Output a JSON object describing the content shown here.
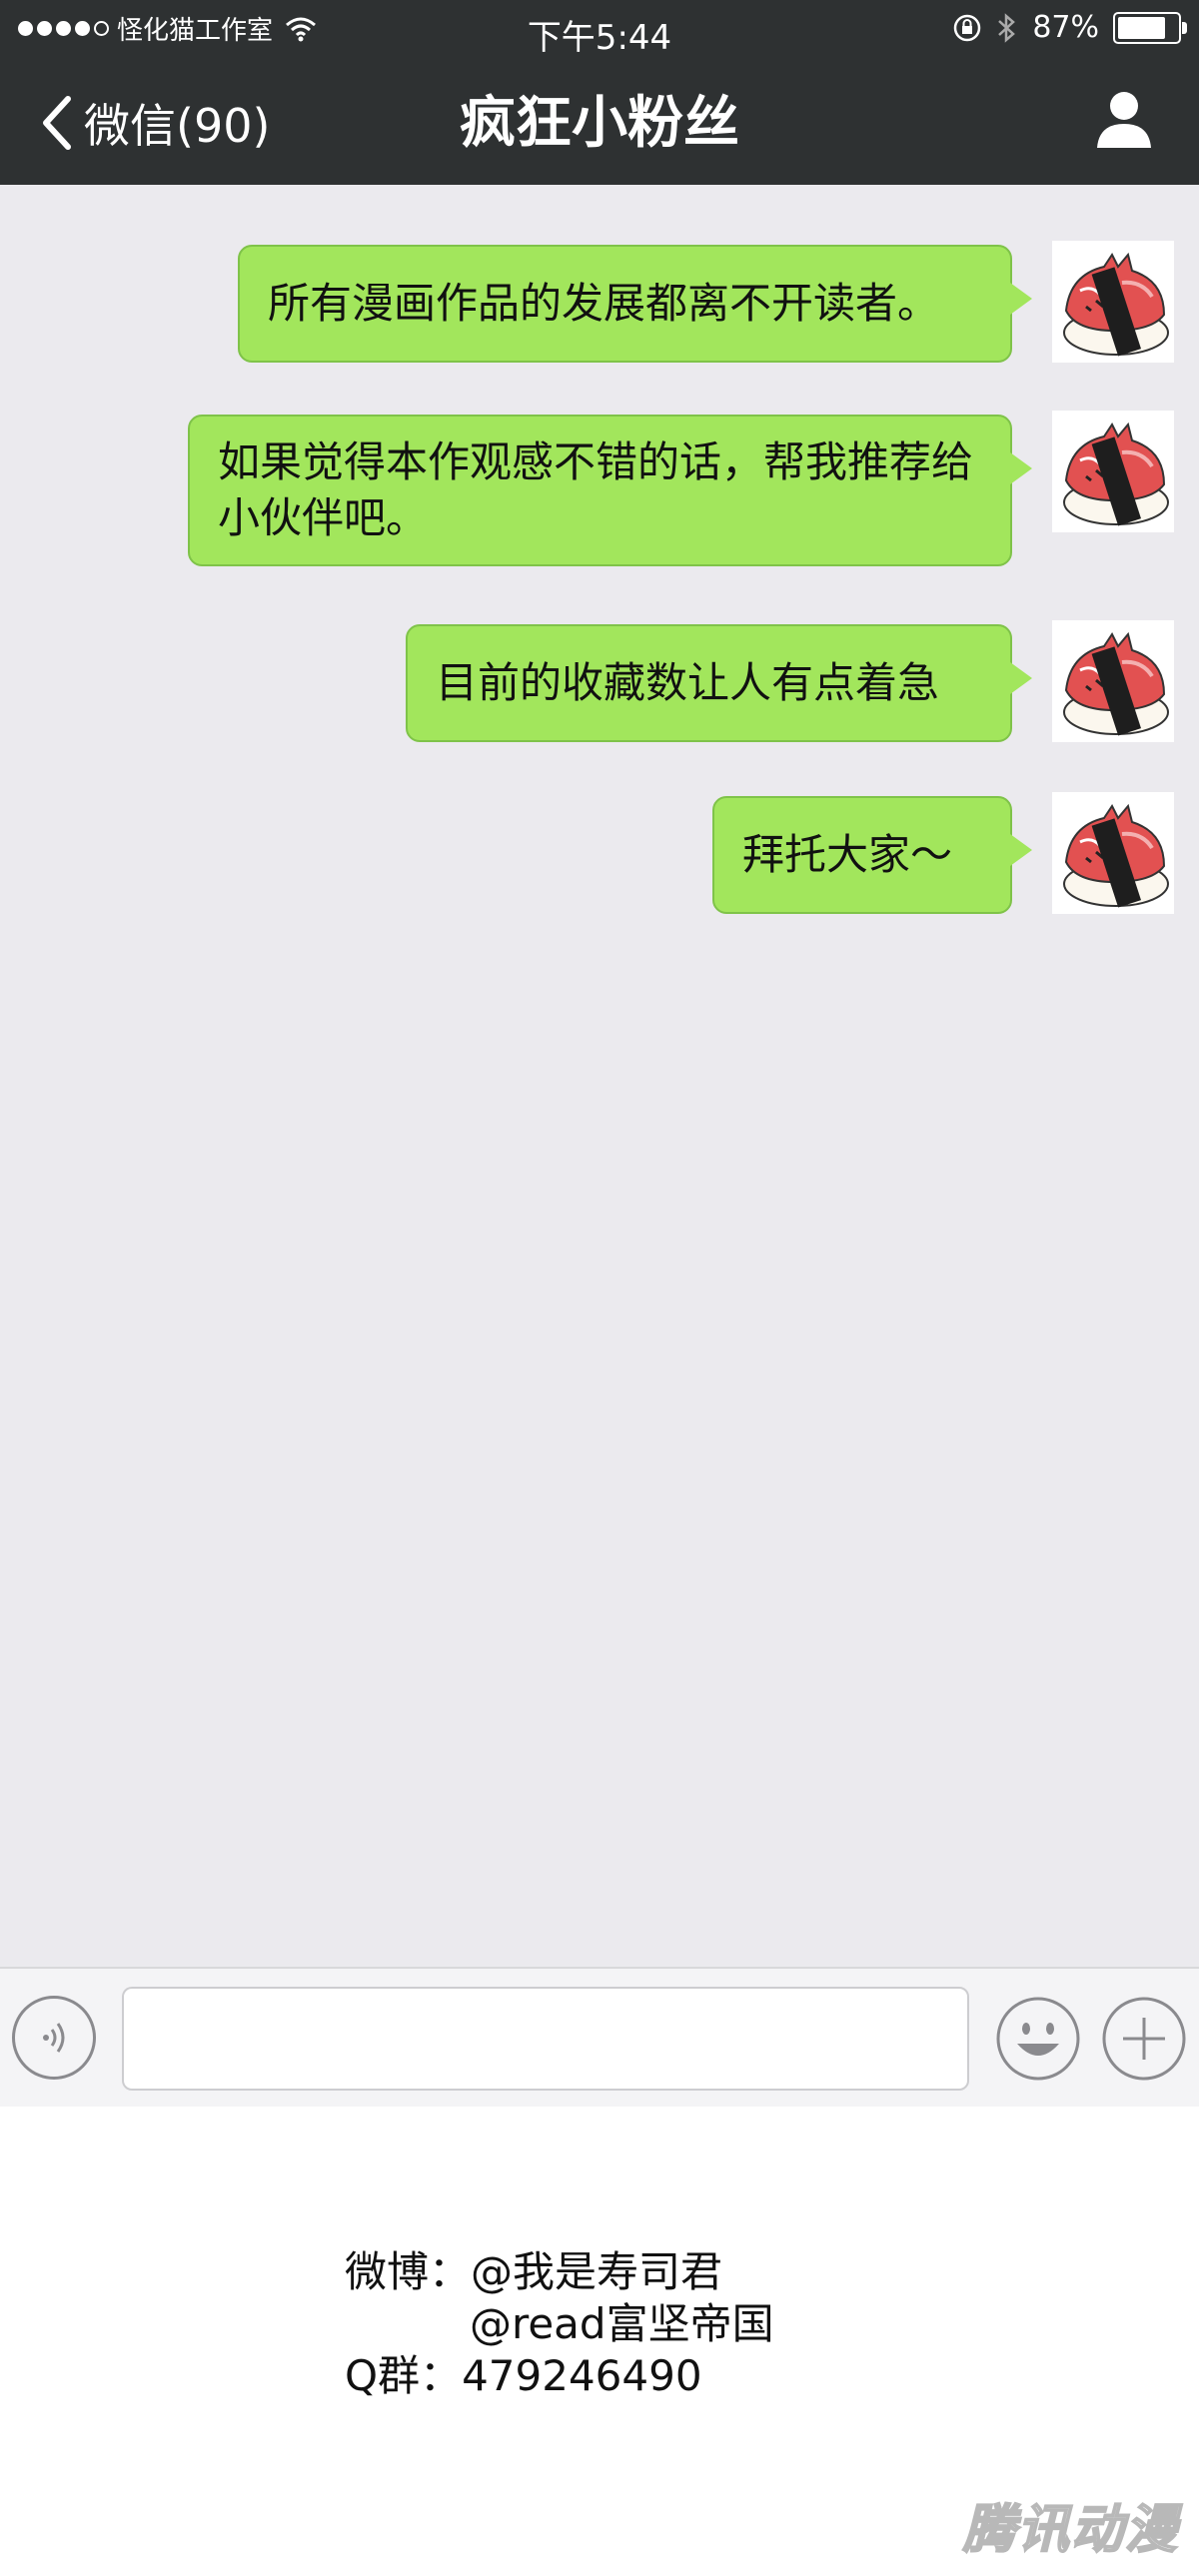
{
  "status_bar": {
    "carrier": "怪化猫工作室",
    "time": "下午5:44",
    "battery": "87%",
    "battery_level": 0.87
  },
  "nav": {
    "back_label": "微信(90)",
    "title": "疯狂小粉丝",
    "profile_icon": "person-icon"
  },
  "messages": [
    {
      "text": "所有漫画作品的发展都离不开读者。",
      "sender": "self"
    },
    {
      "text": "如果觉得本作观感不错的话，帮我推荐给小伙伴吧。",
      "sender": "self"
    },
    {
      "text": "目前的收藏数让人有点着急",
      "sender": "self"
    },
    {
      "text": "拜托大家～",
      "sender": "self"
    }
  ],
  "input_bar": {
    "voice_icon": "voice-icon",
    "emoji_icon": "emoji-icon",
    "plus_icon": "plus-icon",
    "value": ""
  },
  "footer": {
    "weibo_label": "微博：",
    "weibo_1": "@我是寿司君",
    "weibo_2": "@read富坚帝国",
    "qq_label": "Q群：",
    "qq_number": "479246490",
    "watermark": "腾讯动漫"
  },
  "colors": {
    "header_bg": "#2e3132",
    "chat_bg": "#ebeaee",
    "bubble_green": "#a2e65c"
  }
}
